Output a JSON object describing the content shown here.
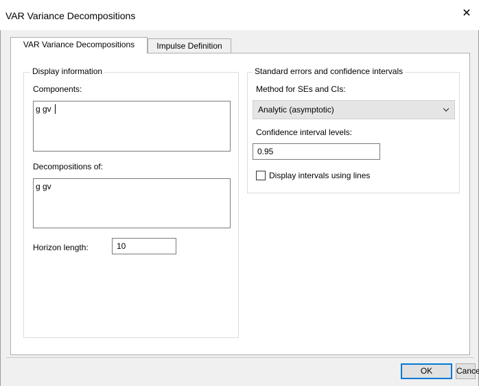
{
  "window": {
    "title": "VAR Variance Decompositions",
    "close_glyph": "✕"
  },
  "tabs": [
    {
      "label": "VAR Variance Decompositions"
    },
    {
      "label": "Impulse Definition"
    }
  ],
  "display_info": {
    "legend": "Display information",
    "components_label": "Components:",
    "components_value": "g gv ",
    "decomp_label": "Decompositions of:",
    "decomp_value": "g gv",
    "horizon_label": "Horizon length:",
    "horizon_value": "10"
  },
  "std_errors": {
    "legend": "Standard errors and confidence intervals",
    "method_label": "Method for SEs and CIs:",
    "method_value": "Analytic (asymptotic)",
    "ci_label": "Confidence interval levels:",
    "ci_value": "0.95",
    "lines_label": "Display intervals using lines",
    "lines_checked": false
  },
  "buttons": {
    "ok": "OK",
    "cancel": "Cancel"
  },
  "icons": {
    "close": "close-icon",
    "dropdown": "chevron-down-icon"
  }
}
